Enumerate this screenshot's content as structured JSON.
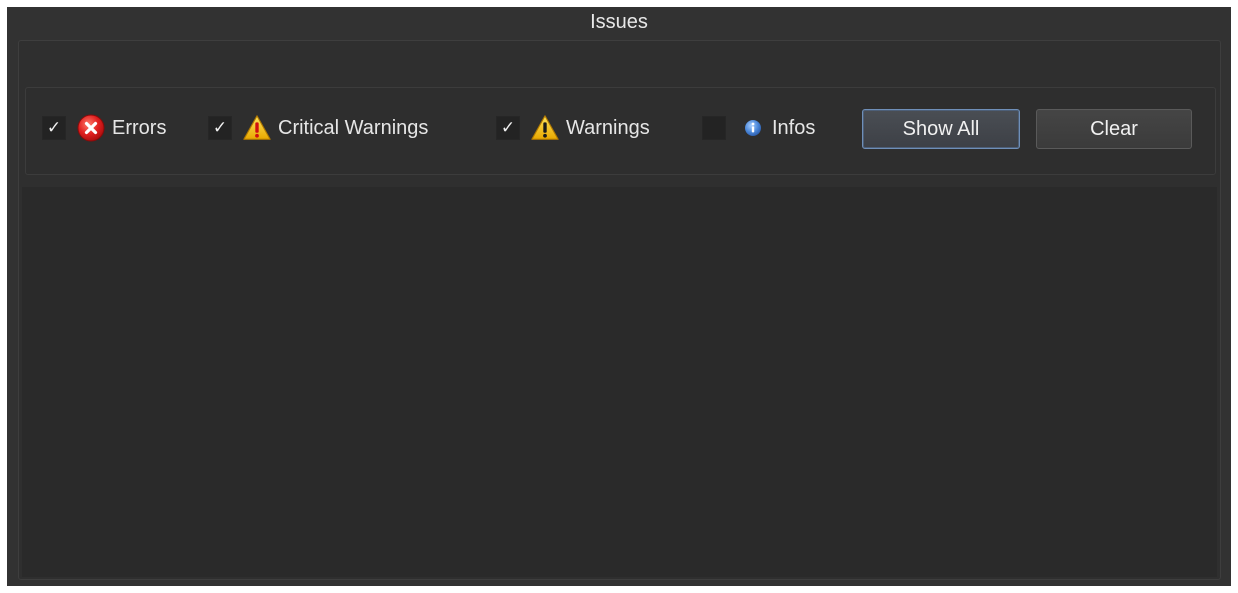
{
  "panel": {
    "title": "Issues"
  },
  "filters": [
    {
      "label": "Errors",
      "checked": true,
      "check_mark": "✓",
      "icon": "error-icon"
    },
    {
      "label": "Critical Warnings",
      "checked": true,
      "check_mark": "✓",
      "icon": "critical-warning-icon"
    },
    {
      "label": "Warnings",
      "checked": true,
      "check_mark": "✓",
      "icon": "warning-icon"
    },
    {
      "label": "Infos",
      "checked": false,
      "check_mark": "",
      "icon": "info-icon"
    }
  ],
  "buttons": {
    "show_all": "Show All",
    "clear": "Clear"
  },
  "colors": {
    "panel_bg": "#323232",
    "list_bg": "#2a2a2a",
    "error_red": "#e02020",
    "warning_yellow": "#f2c200",
    "info_blue": "#4a86d8",
    "focus_border": "#6f8fb8"
  }
}
